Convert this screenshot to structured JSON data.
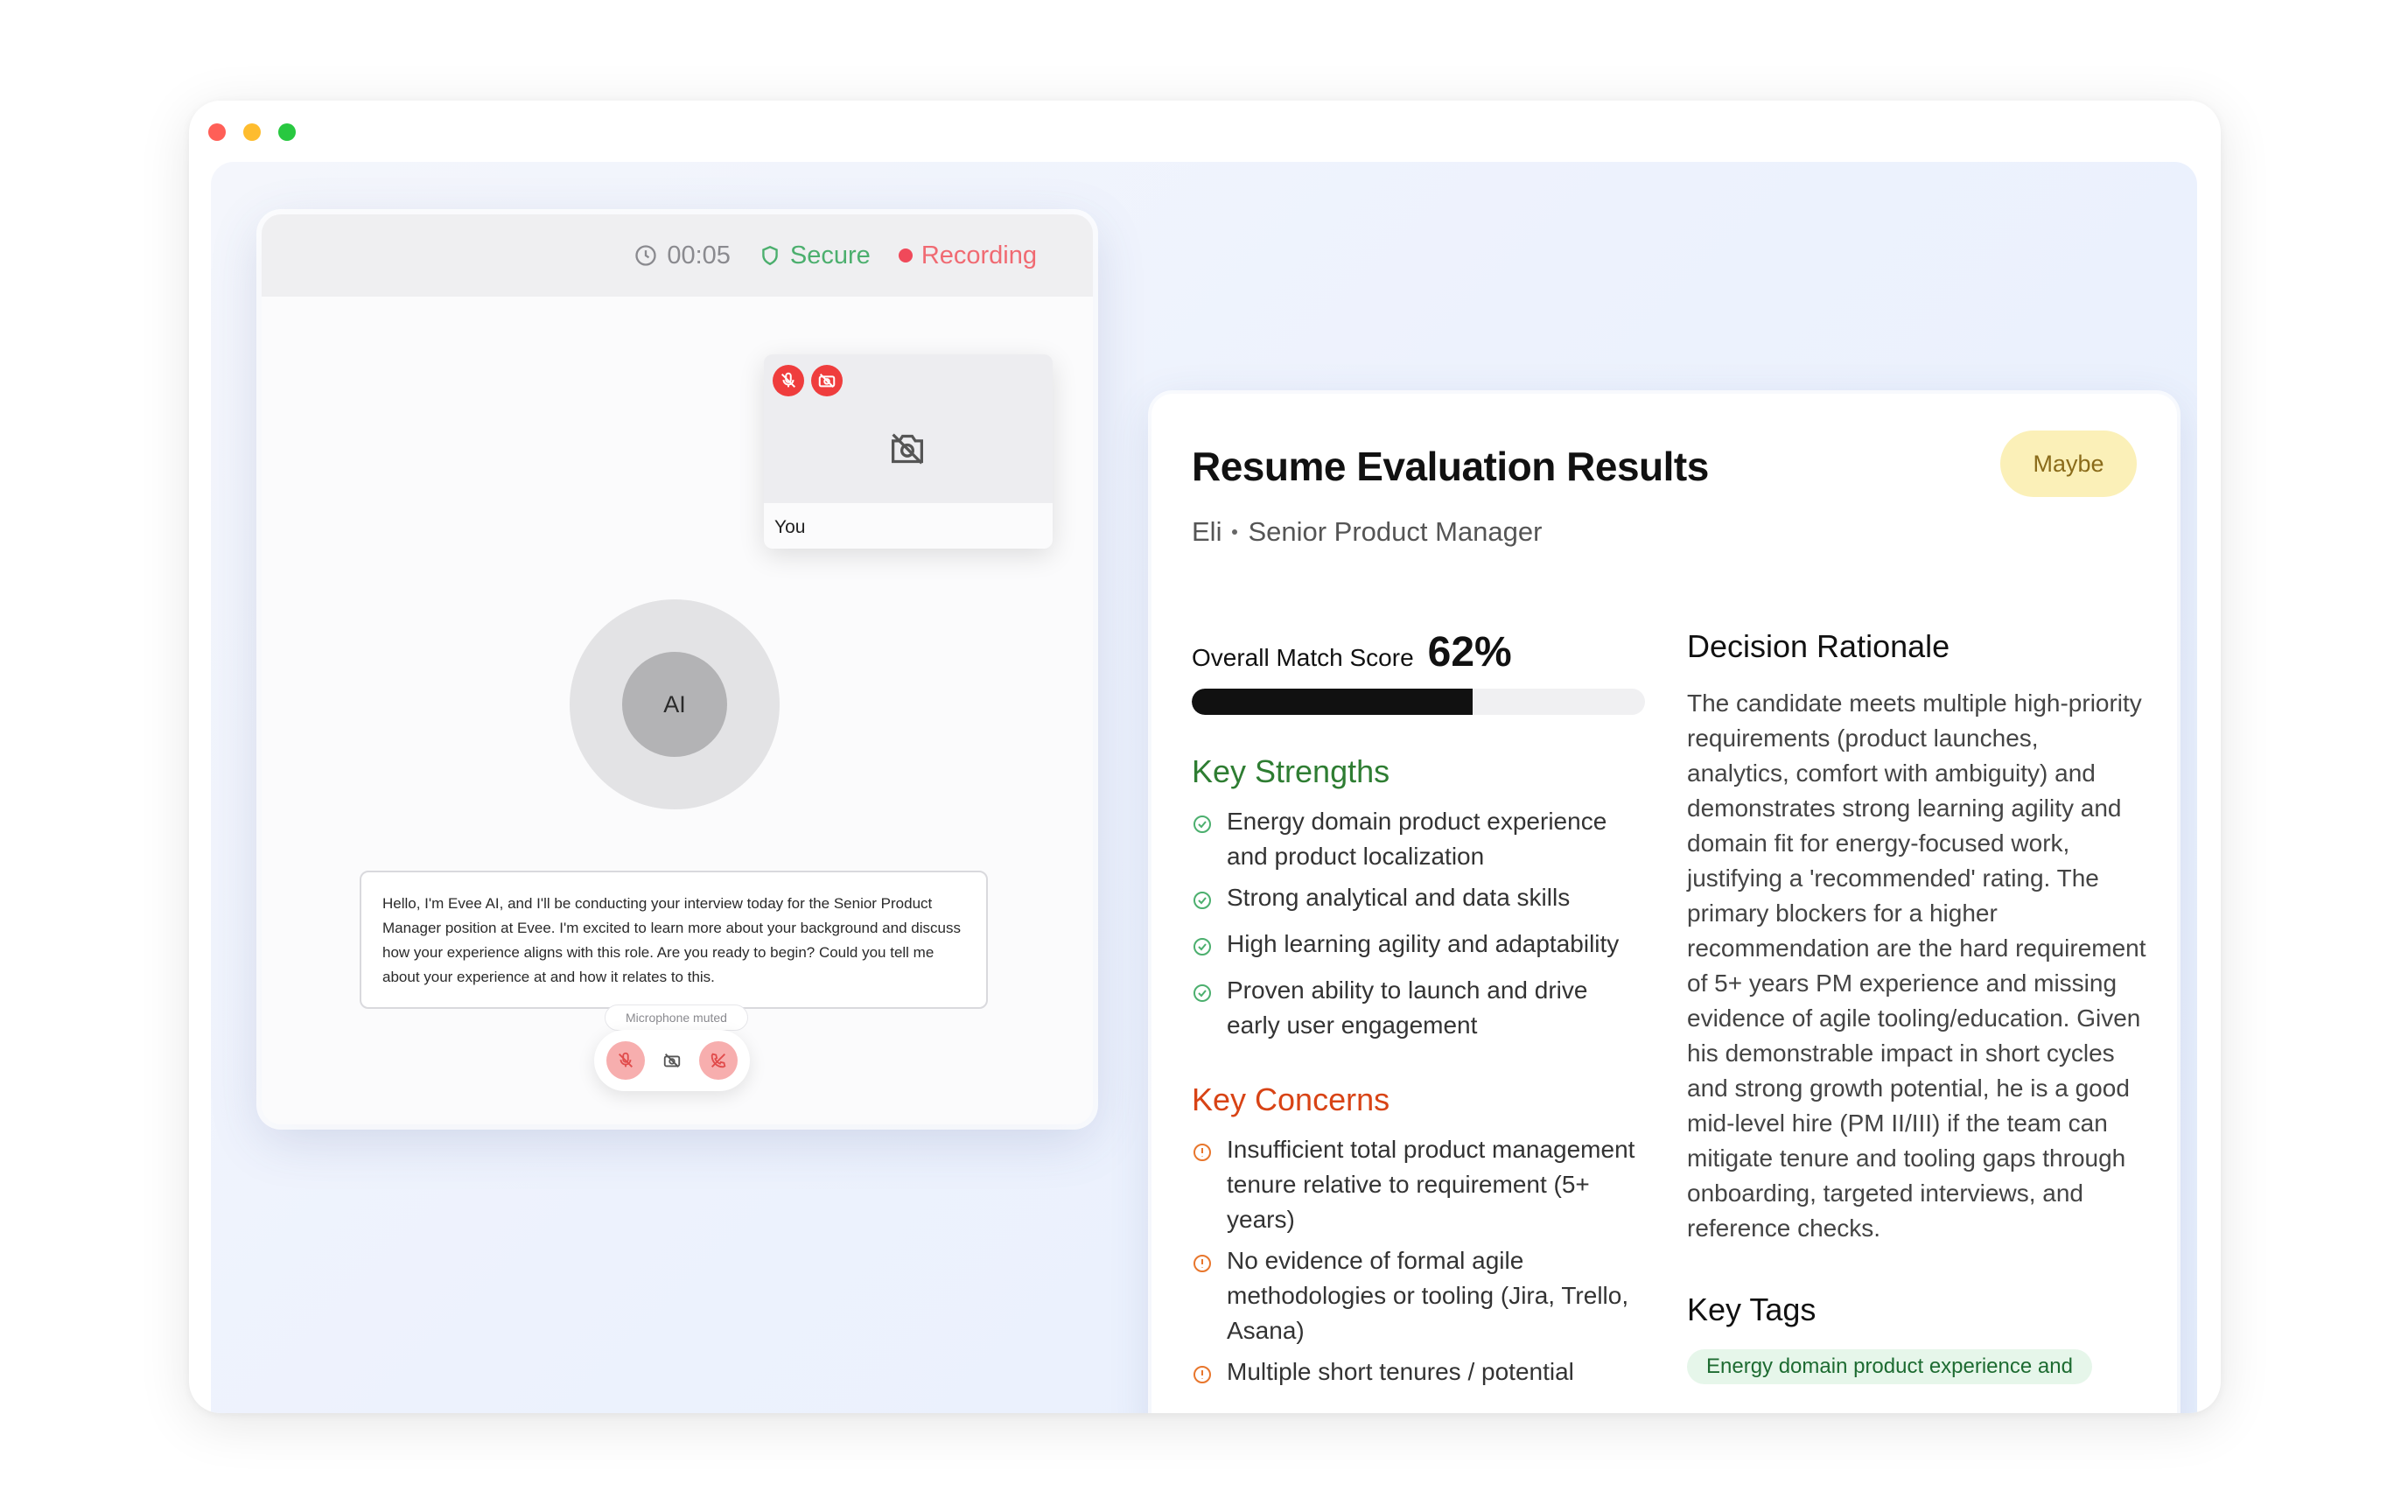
{
  "window": {
    "traffic_lights": [
      "close",
      "minimize",
      "zoom"
    ]
  },
  "call": {
    "timer": "00:05",
    "secure_label": "Secure",
    "recording_label": "Recording",
    "self_label": "You",
    "ai_label": "AI",
    "transcript": "Hello, I'm Evee AI, and I'll be conducting your interview today for the Senior Product Manager position at Evee. I'm excited to learn more about your background and discuss how your experience aligns with this role. Are you ready to begin? Could you tell me about your experience at and how it relates to this.",
    "mic_tooltip": "Microphone muted"
  },
  "results": {
    "title": "Resume Evaluation Results",
    "verdict": "Maybe",
    "candidate_name": "Eli",
    "role": "Senior Product Manager",
    "score_label": "Overall Match Score",
    "score_text": "62%",
    "score_value": 62,
    "strengths_title": "Key Strengths",
    "strengths": [
      "Energy domain product experience and product localization",
      "Strong analytical and data skills",
      "High learning agility and adaptability",
      "Proven ability to launch and drive early user engagement"
    ],
    "concerns_title": "Key Concerns",
    "concerns": [
      "Insufficient total product management tenure relative to requirement (5+ years)",
      "No evidence of formal agile methodologies or tooling (Jira, Trello, Asana)",
      "Multiple short tenures / potential"
    ],
    "rationale_title": "Decision Rationale",
    "rationale": "The candidate meets multiple high-priority requirements (product launches, analytics, comfort with ambiguity) and demonstrates strong learning agility and domain fit for energy-focused work, justifying a 'recommended' rating. The primary blockers for a higher recommendation are the hard requirement of 5+ years PM experience and missing evidence of agile tooling/education. Given his demonstrable impact in short cycles and strong growth potential, he is a good mid-level hire (PM II/III) if the team can mitigate tenure and tooling gaps through onboarding, targeted interviews, and reference checks.",
    "tags_title": "Key Tags",
    "tags": [
      "Energy domain product experience and"
    ]
  },
  "colors": {
    "secure": "#4caf6e",
    "recording": "#f06a72",
    "strengths": "#2e7d32",
    "concerns": "#d84315",
    "verdict_bg": "#fbf0b8"
  }
}
